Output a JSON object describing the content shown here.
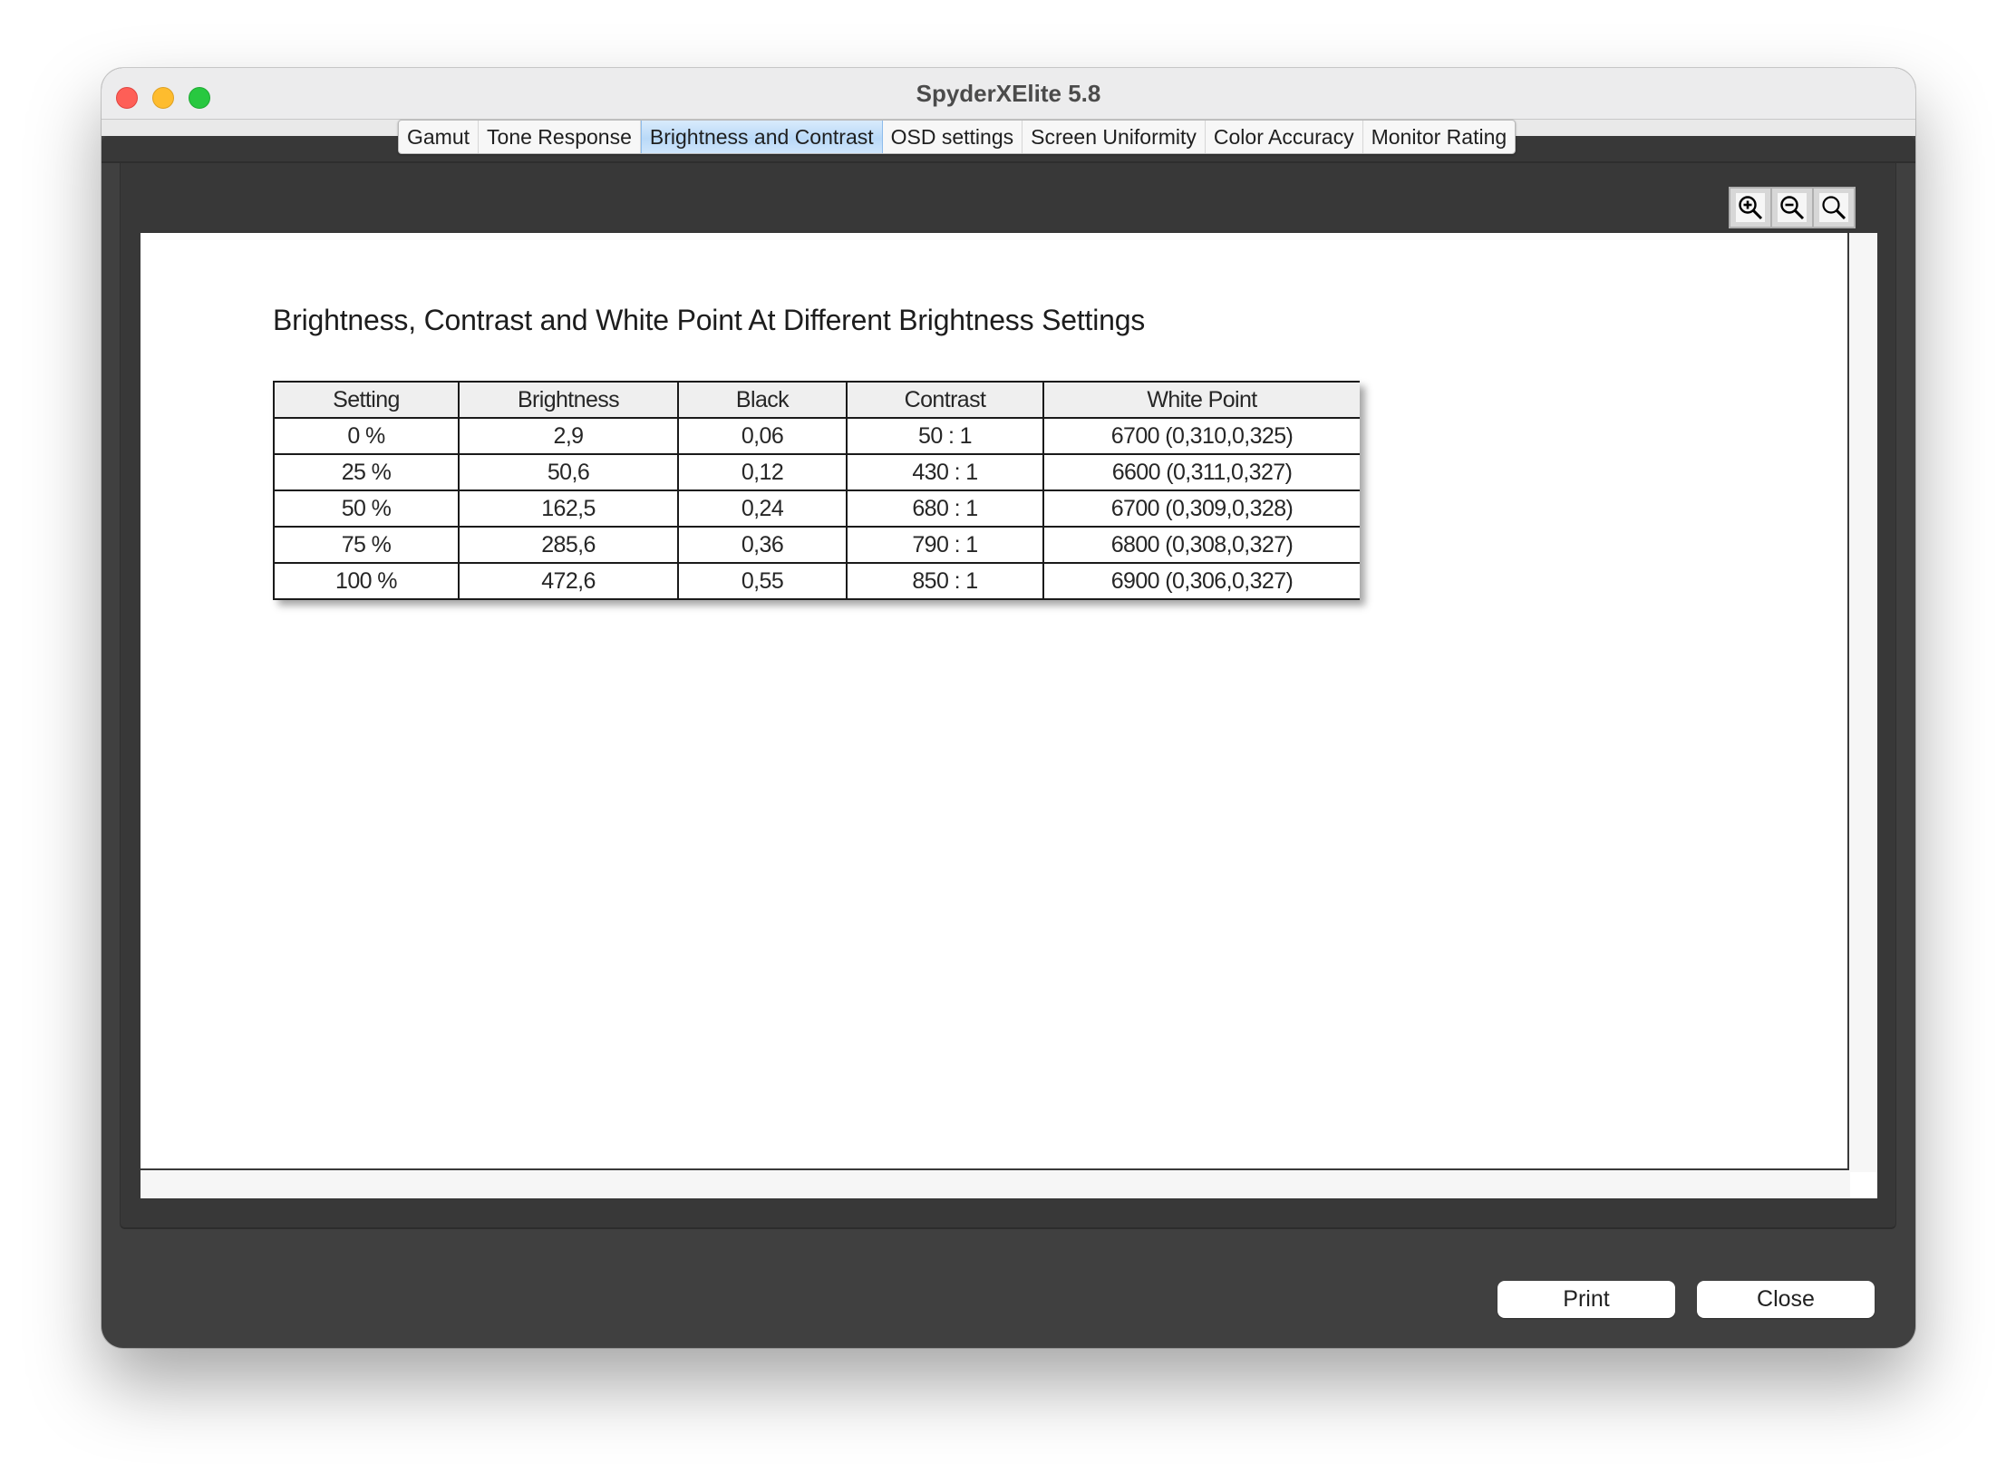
{
  "window": {
    "title": "SpyderXElite 5.8",
    "controls": [
      "close",
      "minimize",
      "maximize"
    ]
  },
  "tabs": [
    {
      "label": "Gamut",
      "active": false
    },
    {
      "label": "Tone Response",
      "active": false
    },
    {
      "label": "Brightness and Contrast",
      "active": true
    },
    {
      "label": "OSD settings",
      "active": false
    },
    {
      "label": "Screen Uniformity",
      "active": false
    },
    {
      "label": "Color Accuracy",
      "active": false
    },
    {
      "label": "Monitor Rating",
      "active": false
    }
  ],
  "zoom_tools": [
    {
      "icon": "zoom-in-icon"
    },
    {
      "icon": "zoom-out-icon"
    },
    {
      "icon": "zoom-fit-icon"
    }
  ],
  "report": {
    "title": "Brightness, Contrast and White Point At Different Brightness Settings",
    "columns": [
      "Setting",
      "Brightness",
      "Black",
      "Contrast",
      "White Point"
    ],
    "rows": [
      [
        "0 %",
        "2,9",
        "0,06",
        "50 : 1",
        "6700 (0,310,0,325)"
      ],
      [
        "25 %",
        "50,6",
        "0,12",
        "430 : 1",
        "6600 (0,311,0,327)"
      ],
      [
        "50 %",
        "162,5",
        "0,24",
        "680 : 1",
        "6700 (0,309,0,328)"
      ],
      [
        "75 %",
        "285,6",
        "0,36",
        "790 : 1",
        "6800 (0,308,0,327)"
      ],
      [
        "100 %",
        "472,6",
        "0,55",
        "850 : 1",
        "6900 (0,306,0,327)"
      ]
    ]
  },
  "buttons": {
    "print": "Print",
    "close": "Close"
  },
  "colors": {
    "active_tab": "#b9d9f8",
    "window_frame": "#404040",
    "panel": "#383838",
    "traffic_close": "#fe5f57",
    "traffic_minimize": "#febc2e",
    "traffic_maximize": "#28c840"
  }
}
